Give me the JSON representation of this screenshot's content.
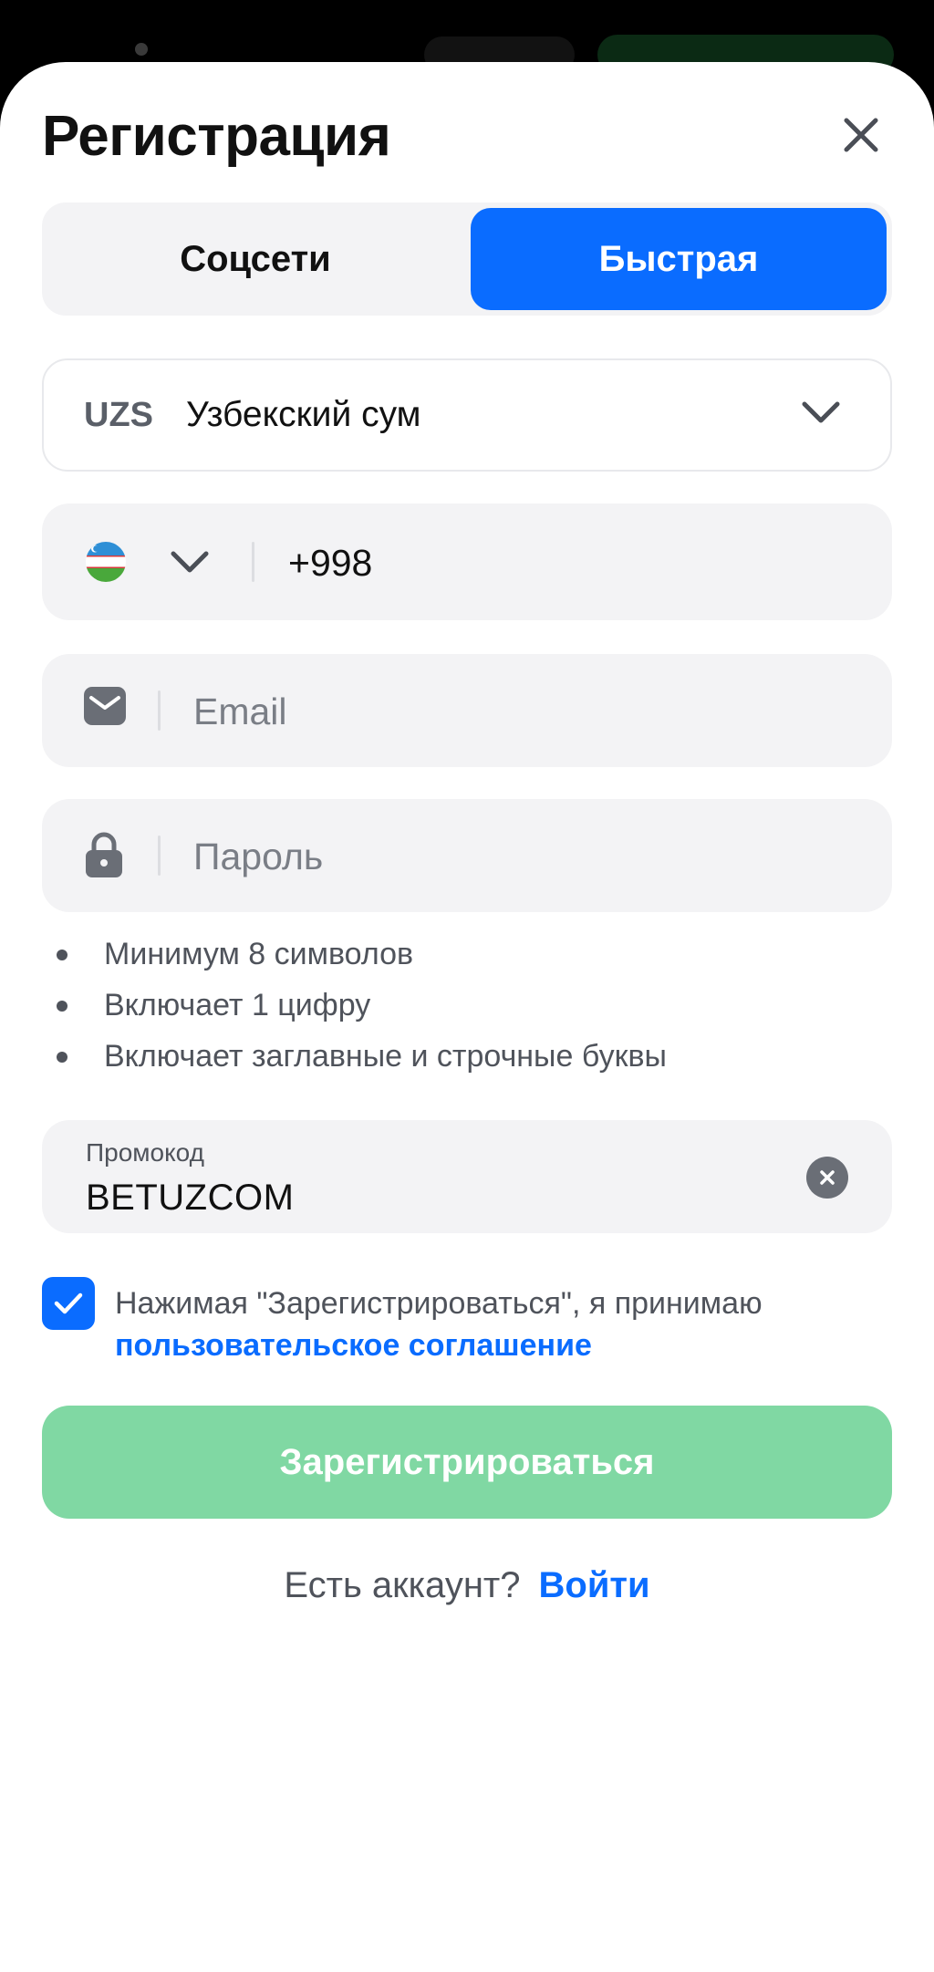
{
  "sheet": {
    "title": "Регистрация",
    "close_icon": "close-icon"
  },
  "tabs": [
    {
      "label": "Соцсети",
      "active": false
    },
    {
      "label": "Быстрая",
      "active": true
    }
  ],
  "currency": {
    "code": "UZS",
    "name": "Узбекский сум",
    "icon": "chevron-down-icon"
  },
  "phone": {
    "country_flag": "uzbekistan-flag-icon",
    "value": "+998"
  },
  "email": {
    "placeholder": "Email",
    "icon": "envelope-icon"
  },
  "password": {
    "placeholder": "Пароль",
    "icon": "lock-icon"
  },
  "password_rules": [
    "Минимум 8 символов",
    "Включает 1 цифру",
    "Включает заглавные и строчные буквы"
  ],
  "promo": {
    "label": "Промокод",
    "value": "BETUZCOM",
    "clear_icon": "clear-icon"
  },
  "agreement": {
    "checked": true,
    "text": "Нажимая \"Зарегистрироваться\", я принимаю",
    "link": "пользовательское соглашение"
  },
  "submit_label": "Зарегистрироваться",
  "login": {
    "prompt": "Есть аккаунт?",
    "link": "Войти"
  },
  "colors": {
    "accent": "#0a6cff",
    "submit_disabled": "#80d8a3",
    "field_bg": "#f3f3f5"
  }
}
